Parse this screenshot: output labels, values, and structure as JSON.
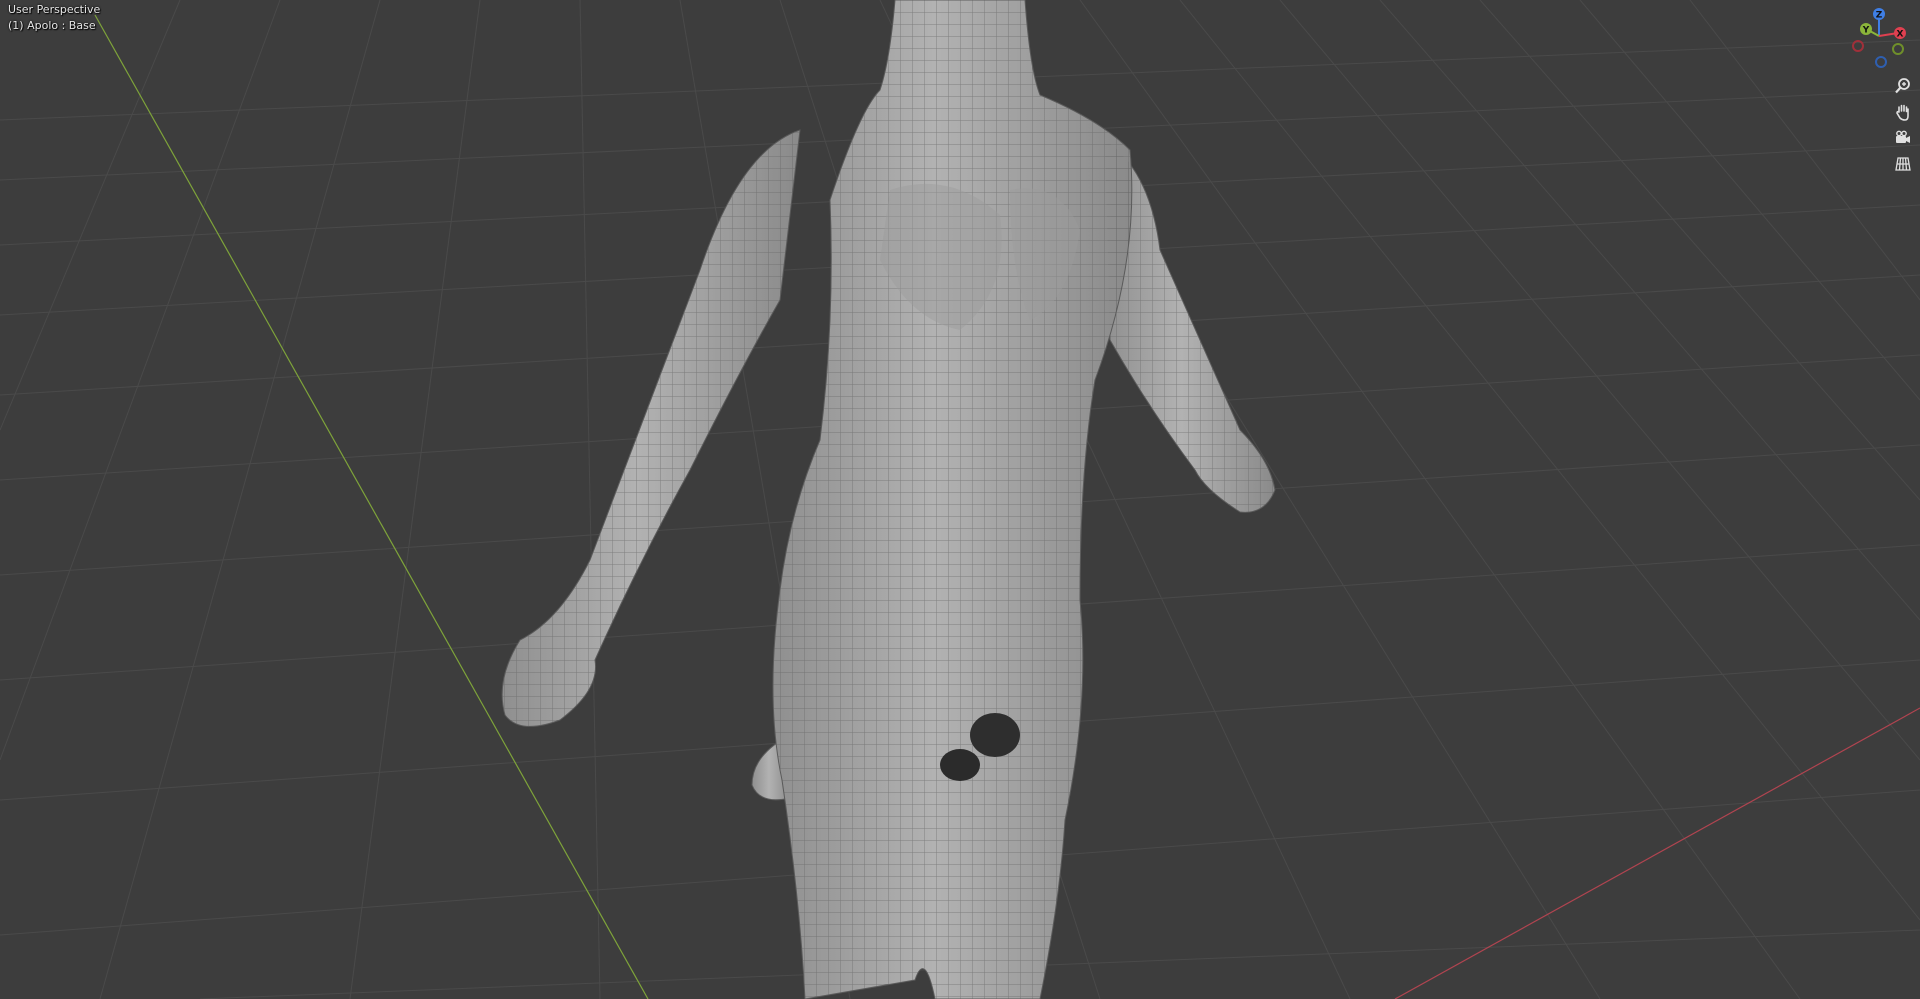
{
  "viewport": {
    "view_name": "User Perspective",
    "object_label": "(1) Apolo : Base"
  },
  "gizmo": {
    "axes": [
      {
        "label": "Z",
        "color": "#3f7fe6"
      },
      {
        "label": "Y",
        "color": "#8bb53a"
      },
      {
        "label": "X",
        "color": "#e04050"
      }
    ]
  },
  "nav_tools": [
    {
      "name": "zoom",
      "icon": "zoom-icon"
    },
    {
      "name": "pan",
      "icon": "hand-icon"
    },
    {
      "name": "camera",
      "icon": "camera-icon"
    },
    {
      "name": "ortho",
      "icon": "grid-icon"
    }
  ],
  "colors": {
    "background": "#3d3d3d",
    "grid": "#4a4a4a",
    "axis_x": "#b04450",
    "axis_y": "#7ea33a",
    "mesh": "#a6a6a6",
    "wire": "#5a5a5a"
  }
}
